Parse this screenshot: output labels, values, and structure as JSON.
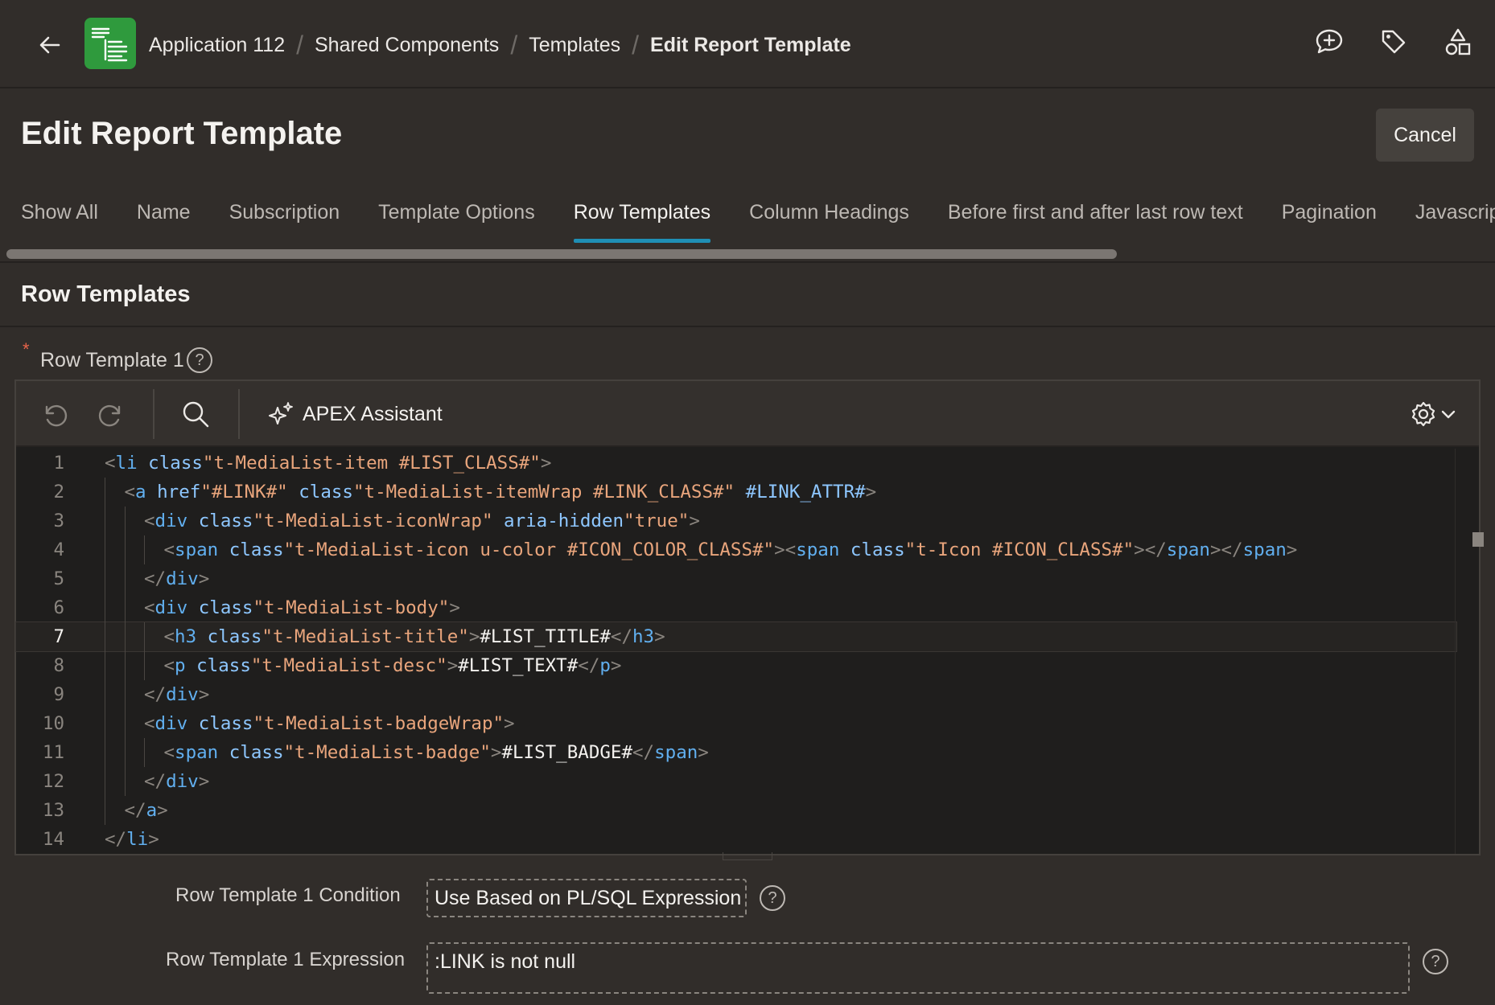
{
  "header": {
    "breadcrumb": [
      "Application 112",
      "Shared Components",
      "Templates",
      "Edit Report Template"
    ]
  },
  "page": {
    "title": "Edit Report Template",
    "cancel_label": "Cancel"
  },
  "tabs": [
    {
      "label": "Show All"
    },
    {
      "label": "Name"
    },
    {
      "label": "Subscription"
    },
    {
      "label": "Template Options"
    },
    {
      "label": "Row Templates",
      "active": true
    },
    {
      "label": "Column Headings"
    },
    {
      "label": "Before first and after last row text"
    },
    {
      "label": "Pagination"
    },
    {
      "label": "Javascript"
    }
  ],
  "section": {
    "title": "Row Templates"
  },
  "row_template": {
    "label": "Row Template 1",
    "assistant_label": "APEX Assistant",
    "line_numbers": [
      "1",
      "2",
      "3",
      "4",
      "5",
      "6",
      "7",
      "8",
      "9",
      "10",
      "11",
      "12",
      "13",
      "14"
    ],
    "code": [
      "<li class=\"t-MediaList-item #LIST_CLASS#\">",
      "<a href=\"#LINK#\" class=\"t-MediaList-itemWrap #LINK_CLASS#\" #LINK_ATTR#>",
      "<div class=\"t-MediaList-iconWrap\" aria-hidden=\"true\">",
      "<span class=\"t-MediaList-icon u-color #ICON_COLOR_CLASS#\"><span class=\"t-Icon #ICON_CLASS#\"></span></span>",
      "</div>",
      "<div class=\"t-MediaList-body\">",
      "<h3 class=\"t-MediaList-title\">#LIST_TITLE#</h3>",
      "<p class=\"t-MediaList-desc\">#LIST_TEXT#</p>",
      "</div>",
      "<div class=\"t-MediaList-badgeWrap\">",
      "<span class=\"t-MediaList-badge\">#LIST_BADGE#</span>",
      "</div>",
      "</a>",
      "</li>"
    ],
    "active_line": 7
  },
  "condition": {
    "label": "Row Template 1 Condition",
    "value": "Use Based on PL/SQL Expression"
  },
  "expression": {
    "label": "Row Template 1 Expression",
    "value": ":LINK is not null"
  },
  "icons": {
    "back": "arrow-left-icon",
    "app": "app-icon",
    "feedback": "chat-plus-icon",
    "tag": "tag-icon",
    "shapes": "shapes-icon",
    "undo": "undo-icon",
    "redo": "redo-icon",
    "search": "search-icon",
    "sparkle": "sparkle-icon",
    "settings": "gear-icon",
    "help": "help-icon"
  },
  "colors": {
    "background": "#312d2a",
    "editor_bg": "#1f1e1d",
    "accent": "#1f8fb5",
    "app_icon": "#2f9a3d",
    "required": "#e8644a"
  }
}
